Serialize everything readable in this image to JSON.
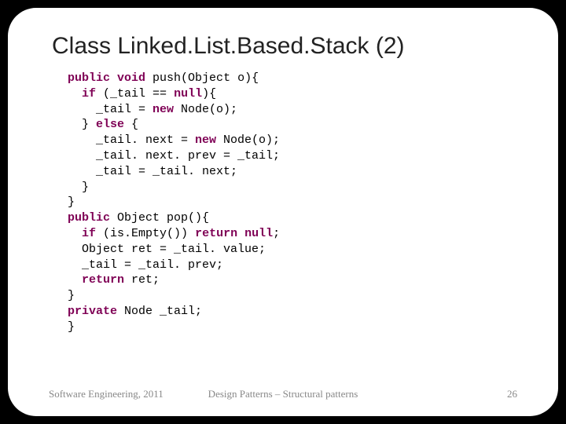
{
  "title": "Class Linked.List.Based.Stack (2)",
  "code": {
    "l1a": "public",
    "l1b": "void",
    "l1c": " push(Object o){",
    "l2a": "if",
    "l2b": " (_tail == ",
    "l2c": "null",
    "l2d": "){",
    "l3a": "    _tail = ",
    "l3b": "new",
    "l3c": " Node(o);",
    "l4a": "  } ",
    "l4b": "else",
    "l4c": " {",
    "l5a": "    _tail. next = ",
    "l5b": "new",
    "l5c": " Node(o);",
    "l6": "    _tail. next. prev = _tail;",
    "l7": "    _tail = _tail. next;",
    "l8": "  }",
    "l9": "}",
    "l10a": "public",
    "l10b": " Object pop(){",
    "l11a": "if",
    "l11b": " (is.Empty()) ",
    "l11c": "return",
    "l11d": "null",
    "l11e": ";",
    "l12": "  Object ret = _tail. value;",
    "l13": "  _tail = _tail. prev;",
    "l14a": "return",
    "l14b": " ret;",
    "l15": "}",
    "l16a": "private",
    "l16b": " Node _tail;",
    "l17": "}"
  },
  "footer": {
    "left": "Software Engineering, 2011",
    "center": "Design Patterns – Structural patterns",
    "right": "26"
  }
}
